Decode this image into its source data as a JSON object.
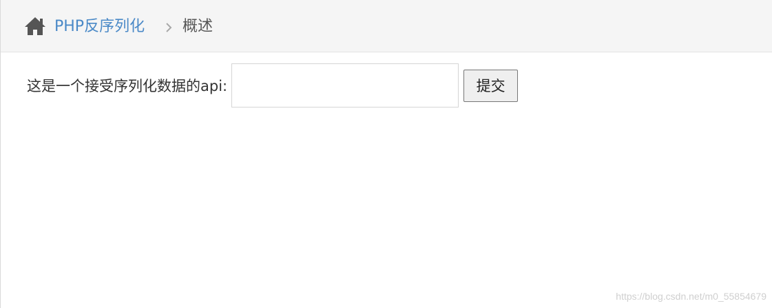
{
  "breadcrumb": {
    "home_icon": "home-icon",
    "link_label": "PHP反序列化",
    "separator_icon": "chevron-right-icon",
    "current_label": "概述"
  },
  "form": {
    "label": "这是一个接受序列化数据的api:",
    "input_value": "",
    "input_placeholder": "",
    "submit_label": "提交"
  },
  "watermark": "https://blog.csdn.net/m0_55854679",
  "colors": {
    "breadcrumb_bg": "#f5f5f5",
    "link": "#4a89c7",
    "text": "#333333",
    "muted": "#555555",
    "watermark": "#cfcfcf"
  }
}
